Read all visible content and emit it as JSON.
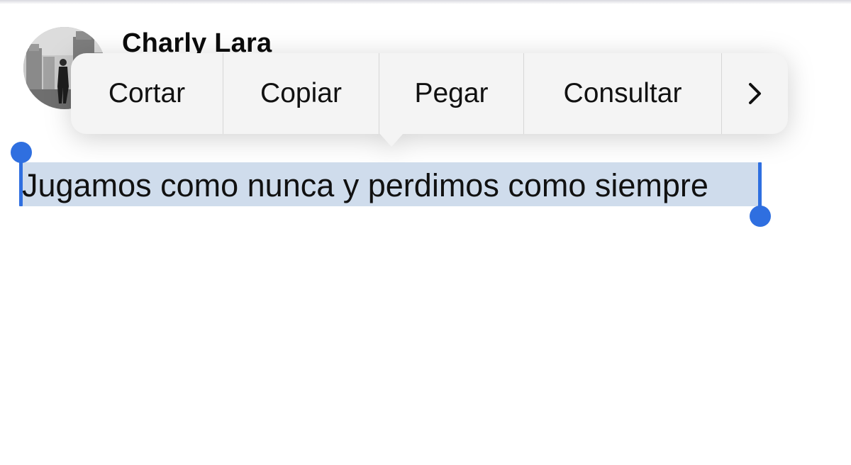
{
  "post": {
    "author": "Charly Lara",
    "text": "Jugamos como nunca y perdimos como siempre"
  },
  "context_menu": {
    "items": [
      {
        "label": "Cortar"
      },
      {
        "label": "Copiar"
      },
      {
        "label": "Pegar"
      },
      {
        "label": "Consultar"
      }
    ],
    "more_icon": "chevron-right-icon"
  },
  "colors": {
    "selection_handle": "#2f6fe0",
    "selection_highlight": "#cfdcec",
    "menu_background": "#f4f4f4"
  }
}
